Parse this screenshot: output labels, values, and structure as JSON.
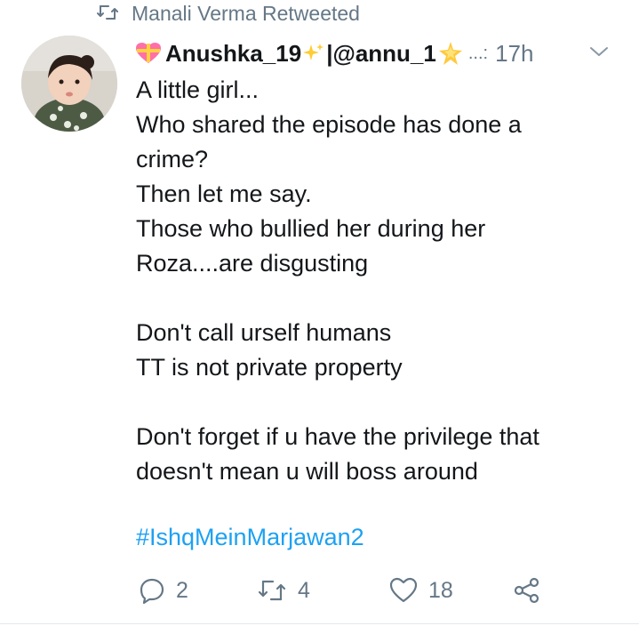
{
  "retweet": {
    "text": "Manali Verma Retweeted"
  },
  "tweet": {
    "name": "Anushka_19",
    "handle": "|@annu_1",
    "ellipsis": "...:",
    "time": "17h",
    "lines": [
      "A little girl...",
      "Who shared the episode has done a",
      "crime?",
      "Then let me say.",
      "Those who bullied her during her",
      "Roza....are  disgusting",
      "",
      "Don't call urself humans",
      "TT is not private property",
      "",
      "Don't forget if u have the privilege that",
      "doesn't mean u will boss around"
    ],
    "hashtag": "#IshqMeinMarjawan2"
  },
  "actions": {
    "reply_count": "2",
    "retweet_count": "4",
    "like_count": "18"
  },
  "colors": {
    "muted": "#657786",
    "link": "#1da1f2",
    "text": "#14171a",
    "heart_emoji": "#ff6fa8",
    "sparkle": "#ffcc33"
  },
  "icons": {
    "retweet": "retweet-icon",
    "caret": "chevron-down-icon",
    "reply": "reply-icon",
    "like": "heart-icon",
    "share": "share-icon"
  }
}
